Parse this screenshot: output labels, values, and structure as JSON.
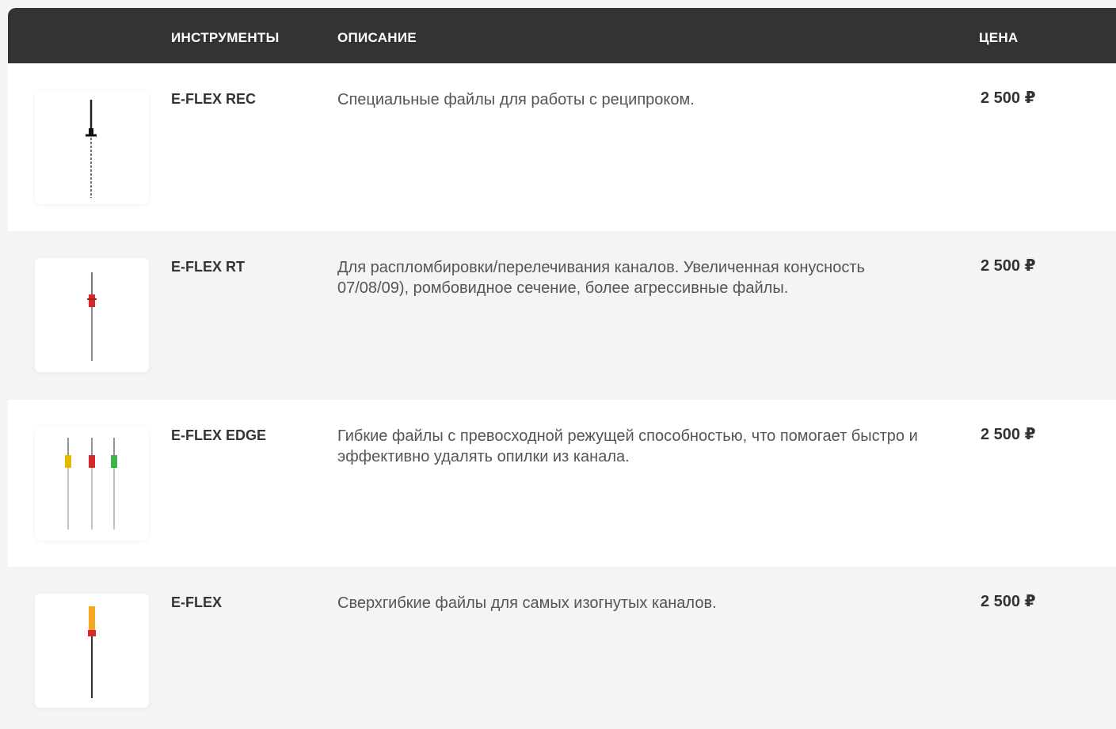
{
  "header": {
    "tools": "ИНСТРУМЕНТЫ",
    "description": "ОПИСАНИЕ",
    "price": "ЦЕНА"
  },
  "rows": [
    {
      "name": "E-FLEX REC",
      "description": "Специальные файлы для работы с реципроком.",
      "price": "2 500 ₽",
      "icon": "black-endo-file-icon"
    },
    {
      "name": "E-FLEX RT",
      "description": "Для распломбировки/перелечивания каналов. Увеличенная конусность  07/08/09), ромбовидное сечение, более агрессивные файлы.",
      "price": "2 500 ₽",
      "icon": "red-endo-file-icon"
    },
    {
      "name": "E-FLEX EDGE",
      "description": "Гибкие файлы с превосходной режущей способностью, что помогает быстро и эффективно удалять опилки из канала.",
      "price": "2 500 ₽",
      "icon": "three-endo-files-icon"
    },
    {
      "name": "E-FLEX",
      "description": "Сверхгибкие файлы для самых изогнутых каналов.",
      "price": "2 500 ₽",
      "icon": "orange-endo-file-icon"
    }
  ],
  "colors": {
    "header_bg": "#333333",
    "header_text": "#ffffff",
    "row_alt_bg": "#f3f4f6",
    "text_dark": "#333333",
    "text_muted": "#555555"
  }
}
